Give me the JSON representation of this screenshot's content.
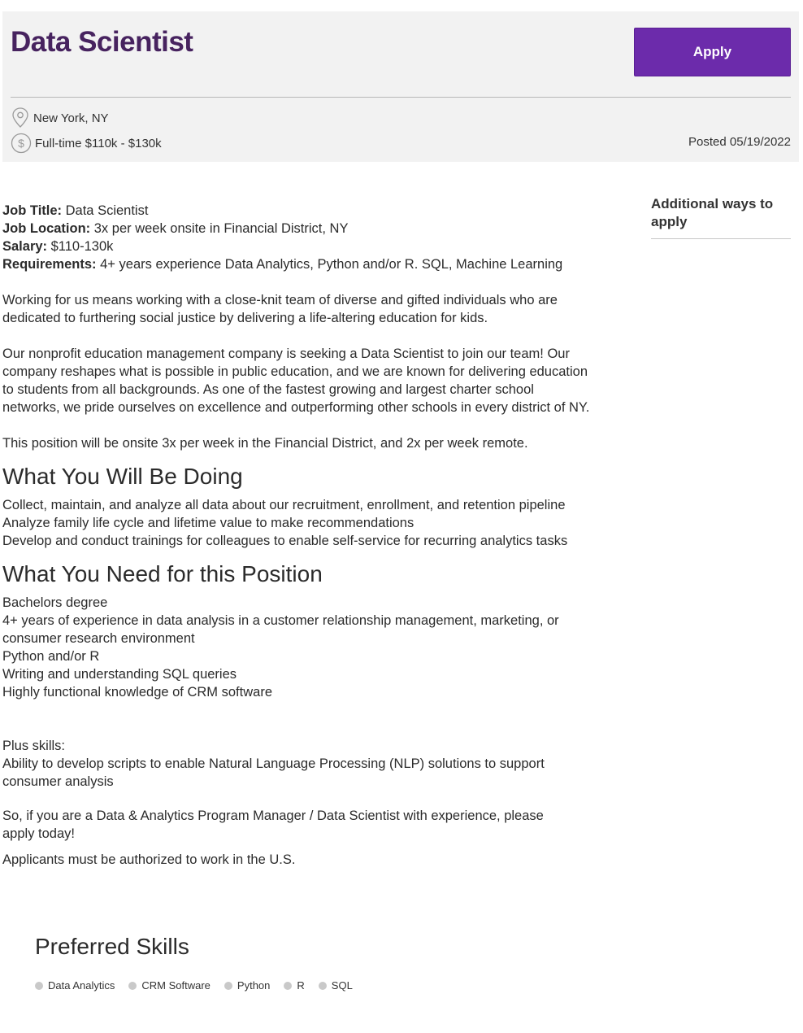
{
  "header": {
    "title": "Data Scientist",
    "apply_label": "Apply",
    "location": "New York, NY",
    "employment": "Full-time $110k - $130k",
    "posted": "Posted 05/19/2022",
    "icons": {
      "location": "map-pin-icon",
      "salary": "dollar-circle-icon"
    }
  },
  "sidebar": {
    "heading": "Additional ways to apply"
  },
  "details": {
    "job_title_label": "Job Title:",
    "job_title_value": " Data Scientist",
    "job_location_label": "Job Location:",
    "job_location_value": " 3x per week onsite in Financial District, NY",
    "salary_label": "Salary:",
    "salary_value": " $110-130k",
    "requirements_label": "Requirements:",
    "requirements_value": " 4+ years experience Data Analytics, Python and/or R. SQL, Machine Learning"
  },
  "description": {
    "p1": "Working for us means working with a close-knit team of diverse and gifted individuals who are dedicated to furthering social justice by delivering a life-altering education for kids.",
    "p2": "Our nonprofit education management company is seeking a Data Scientist to join our team! Our company reshapes what is possible in public education, and we are known for delivering education to students from all backgrounds. As one of the fastest growing and largest charter school networks, we pride ourselves on excellence and outperforming other schools in every district of NY.",
    "p3": "This position will be onsite 3x per week in the Financial District, and 2x per week remote."
  },
  "doing": {
    "heading": "What You Will Be Doing",
    "items": [
      "Collect, maintain, and analyze all data about our recruitment, enrollment, and retention pipeline",
      "Analyze family life cycle and lifetime value to make recommendations",
      "Develop and conduct trainings for colleagues to enable self-service for recurring analytics tasks"
    ]
  },
  "need": {
    "heading": "What You Need for this Position",
    "items": [
      "Bachelors degree",
      "4+ years of experience in data analysis in a customer relationship management, marketing, or consumer research environment",
      "Python and/or R",
      "Writing and understanding SQL queries",
      "Highly functional knowledge of CRM software"
    ],
    "plus_label": "Plus skills:",
    "plus_item": "Ability to develop scripts to enable Natural Language Processing (NLP) solutions to support consumer analysis"
  },
  "closing": {
    "p1": "So, if you are a Data & Analytics Program Manager / Data Scientist with experience, please apply today!",
    "p2": "Applicants must be authorized to work in the U.S."
  },
  "preferred": {
    "heading": "Preferred Skills",
    "skills": [
      "Data Analytics",
      "CRM Software",
      "Python",
      "R",
      "SQL"
    ]
  }
}
